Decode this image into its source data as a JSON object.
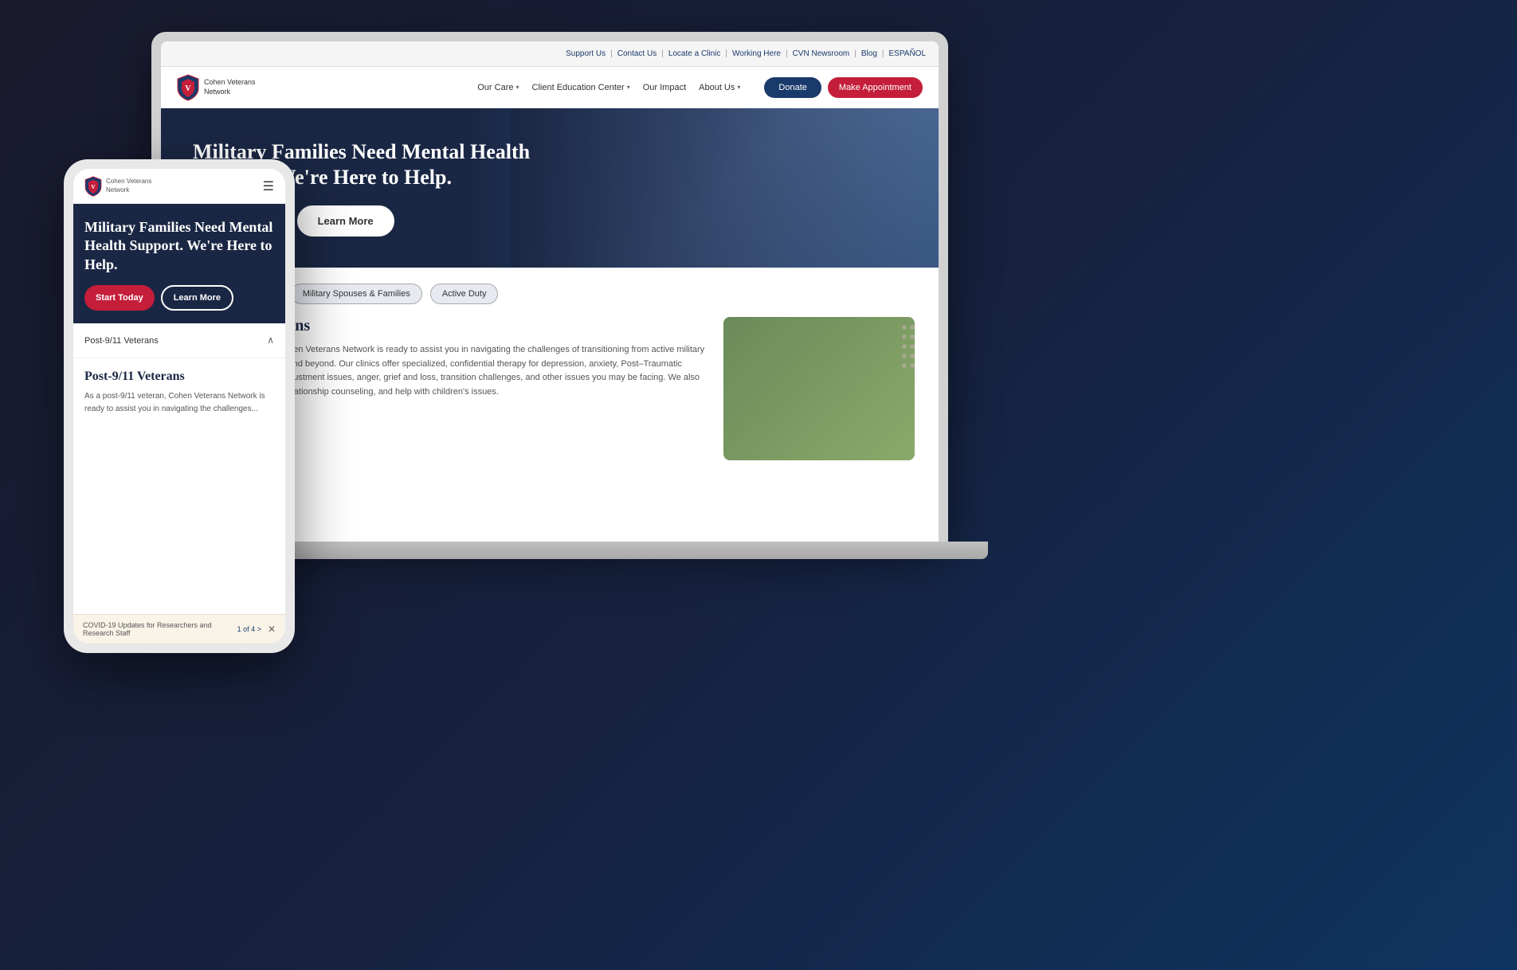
{
  "scene": {
    "bg_color": "#1a1a2e"
  },
  "topbar": {
    "links": [
      {
        "label": "Support Us",
        "id": "support-us"
      },
      {
        "label": "Contact Us",
        "id": "contact-us"
      },
      {
        "label": "Locate a Clinic",
        "id": "locate-clinic"
      },
      {
        "label": "Working Here",
        "id": "working-here"
      },
      {
        "label": "CVN Newsroom",
        "id": "cvn-newsroom"
      },
      {
        "label": "Blog",
        "id": "blog"
      },
      {
        "label": "ESPAÑOL",
        "id": "espanol"
      }
    ]
  },
  "laptop_navbar": {
    "logo_line1": "Cohen Veterans",
    "logo_line2": "Network",
    "nav_items": [
      {
        "label": "Our Care",
        "has_dropdown": true
      },
      {
        "label": "Client Education Center",
        "has_dropdown": true
      },
      {
        "label": "Our Impact",
        "has_dropdown": false
      },
      {
        "label": "About Us",
        "has_dropdown": true
      }
    ],
    "donate_label": "Donate",
    "appointment_label": "Make Appointment"
  },
  "hero": {
    "title": "Military Families Need Mental Health Support. We're Here to Help.",
    "btn_start": "Start Today",
    "btn_learn": "Learn More"
  },
  "tabs": [
    {
      "label": "Post-9/11 Veterans",
      "active": false
    },
    {
      "label": "Military Spouses & Families",
      "active": false
    },
    {
      "label": "Active Duty",
      "active": false
    }
  ],
  "content": {
    "section_title": "Post-9/11 Veterans",
    "paragraph": "As a post-9/11 veteran, Cohen Veterans Network is ready to assist you in navigating the challenges of transitioning from active military service back to civilian life and beyond. Our clinics offer specialized, confidential therapy for depression, anxiety, Post–Traumatic Stress Disorder (PTSD), adjustment issues, anger, grief and loss, transition challenges, and other issues you may be facing. We also offer couples counseling, relationship counseling, and help with children's issues."
  },
  "phone": {
    "logo_line1": "Cohen Veterans",
    "logo_line2": "Network",
    "hero_title": "Military Families Need Mental Health Support. We're Here to Help.",
    "btn_start": "Start Today",
    "btn_learn": "Learn More",
    "accordion_label": "Post-9/11 Veterans",
    "section_title": "Post-9/11 Veterans",
    "para": "As a post-9/11 veteran, Cohen Veterans Network is ready to assist you in navigating the challenges...",
    "notification_text": "COVID-19 Updates for Researchers and Research Staff",
    "notification_count": "1 of 4 >"
  }
}
